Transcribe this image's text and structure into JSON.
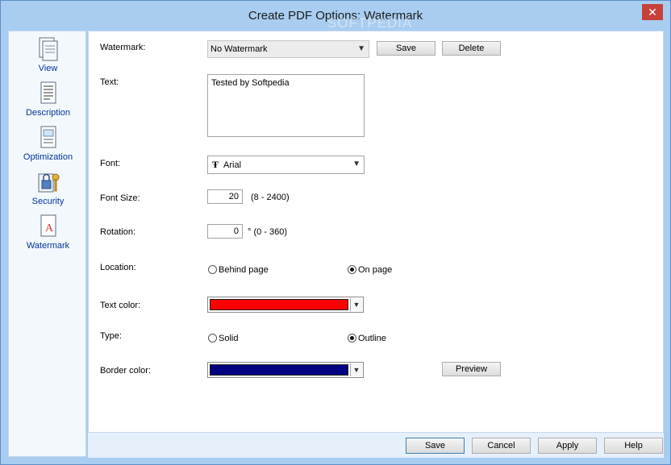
{
  "window": {
    "title": "Create PDF Options: Watermark",
    "close_glyph": "✕"
  },
  "sidebar": {
    "items": [
      {
        "label": "View",
        "icon": "view-icon"
      },
      {
        "label": "Description",
        "icon": "description-icon"
      },
      {
        "label": "Optimization",
        "icon": "optimization-icon"
      },
      {
        "label": "Security",
        "icon": "security-icon"
      },
      {
        "label": "Watermark",
        "icon": "watermark-icon"
      }
    ],
    "active": "Watermark"
  },
  "form": {
    "watermark": {
      "label": "Watermark:",
      "value": "No Watermark",
      "save": "Save",
      "delete": "Delete"
    },
    "text": {
      "label": "Text:",
      "value": "Tested by Softpedia"
    },
    "font": {
      "label": "Font:",
      "value": "Arial",
      "glyph": "Ŧ"
    },
    "font_size": {
      "label": "Font Size:",
      "value": "20",
      "range": "(8  -  2400)"
    },
    "rotation": {
      "label": "Rotation:",
      "value": "0",
      "range": "° (0  -  360)"
    },
    "location": {
      "label": "Location:",
      "options": [
        "Behind page",
        "On page"
      ],
      "selected": "On page"
    },
    "text_color": {
      "label": "Text color:",
      "color": "#ff0000"
    },
    "type": {
      "label": "Type:",
      "options": [
        "Solid",
        "Outline"
      ],
      "selected": "Outline"
    },
    "border_color": {
      "label": "Border color:",
      "color": "#000080"
    },
    "preview": "Preview"
  },
  "footer": {
    "save": "Save",
    "cancel": "Cancel",
    "apply": "Apply",
    "help": "Help"
  },
  "watermark_overlay": "SOFTPEDIA"
}
